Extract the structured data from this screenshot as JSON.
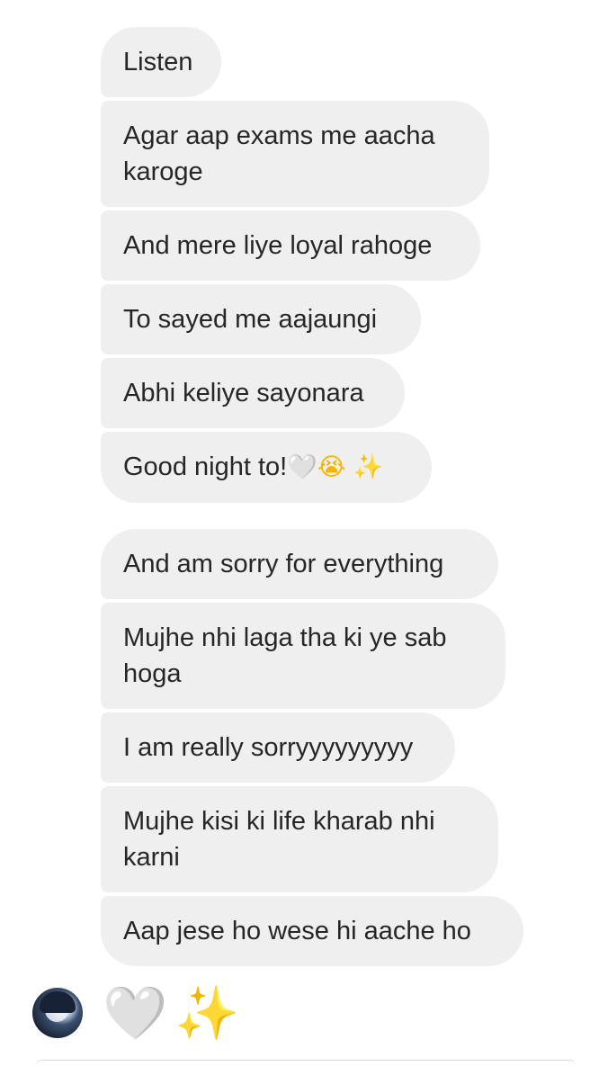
{
  "thread": {
    "group1": [
      "Listen",
      "Agar aap exams me aacha karoge",
      "And mere liye loyal rahoge",
      "To sayed me aajaungi",
      "Abhi keliye sayonara"
    ],
    "goodnight": {
      "text": "Good night to!",
      "emoji_heart": "🤍",
      "emoji_cry": "😭",
      "emoji_sparkles": "✨"
    },
    "group2": [
      "And am sorry for everything",
      "Mujhe nhi laga tha ki ye sab hoga",
      "I am really sorryyyyyyyyy",
      "Mujhe kisi ki life kharab nhi karni",
      "Aap jese ho wese hi aache ho"
    ]
  },
  "emoji_message": {
    "heart": "🤍",
    "sparkles": "✨"
  },
  "colors": {
    "bubble": "#efefef",
    "text": "#262626"
  },
  "icons": {
    "sender_avatar": "avatar-icon"
  }
}
